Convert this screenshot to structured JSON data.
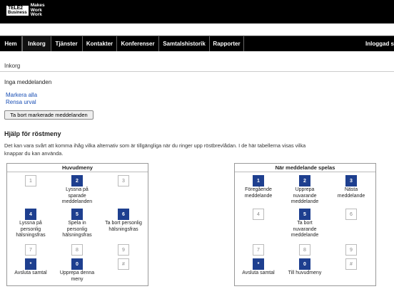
{
  "logo": {
    "brand": "TELE2",
    "sub": "Business",
    "tagline": "Makes Work Work"
  },
  "nav": {
    "items": [
      "Hem",
      "Inkorg",
      "Tjänster",
      "Kontakter",
      "Konferenser",
      "Samtalshistorik",
      "Rapporter"
    ],
    "active": "Inkorg",
    "user": "Inloggad s"
  },
  "breadcrumb": "Inkorg",
  "inbox": {
    "empty_message": "Inga meddelanden",
    "select_all": "Markera alla",
    "clear_selection": "Rensa urval",
    "delete_button": "Ta bort markerade meddelanden"
  },
  "help": {
    "title": "Hjälp för röstmeny",
    "text": "Det kan vara svårt att komma ihåg vilka alternativ som är tillgängliga när du ringer upp röstbrevlådan. I de här tabellerna visas vilka knappar du kan använda."
  },
  "menus": [
    {
      "title": "Huvudmeny",
      "keys": [
        {
          "key": "1",
          "active": false,
          "label": ""
        },
        {
          "key": "2",
          "active": true,
          "label": "Lyssna på sparade meddelanden"
        },
        {
          "key": "3",
          "active": false,
          "label": ""
        },
        {
          "key": "4",
          "active": true,
          "label": "Lyssna på personlig hälsningsfras"
        },
        {
          "key": "5",
          "active": true,
          "label": "Spela in personlig hälsningsfras"
        },
        {
          "key": "6",
          "active": true,
          "label": "Ta bort personlig hälsningsfras"
        },
        {
          "key": "7",
          "active": false,
          "label": ""
        },
        {
          "key": "8",
          "active": false,
          "label": ""
        },
        {
          "key": "9",
          "active": false,
          "label": ""
        },
        {
          "key": "*",
          "active": true,
          "label": "Avsluta samtal"
        },
        {
          "key": "0",
          "active": true,
          "label": "Upprepa denna meny"
        },
        {
          "key": "#",
          "active": false,
          "label": ""
        }
      ]
    },
    {
      "title": "När meddelande spelas",
      "keys": [
        {
          "key": "1",
          "active": true,
          "label": "Föregående meddelande"
        },
        {
          "key": "2",
          "active": true,
          "label": "Upprepa nuvarande meddelande"
        },
        {
          "key": "3",
          "active": true,
          "label": "Nästa meddelande"
        },
        {
          "key": "4",
          "active": false,
          "label": ""
        },
        {
          "key": "5",
          "active": true,
          "label": "Ta bort nuvarande meddelande"
        },
        {
          "key": "6",
          "active": false,
          "label": ""
        },
        {
          "key": "7",
          "active": false,
          "label": ""
        },
        {
          "key": "8",
          "active": false,
          "label": ""
        },
        {
          "key": "9",
          "active": false,
          "label": ""
        },
        {
          "key": "*",
          "active": true,
          "label": "Avsluta samtal"
        },
        {
          "key": "0",
          "active": true,
          "label": "Till huvudmeny"
        },
        {
          "key": "#",
          "active": false,
          "label": ""
        }
      ]
    }
  ],
  "colors": {
    "key_active": "#1e3f8f",
    "link": "#1a4fb5",
    "bar": "#000000"
  }
}
